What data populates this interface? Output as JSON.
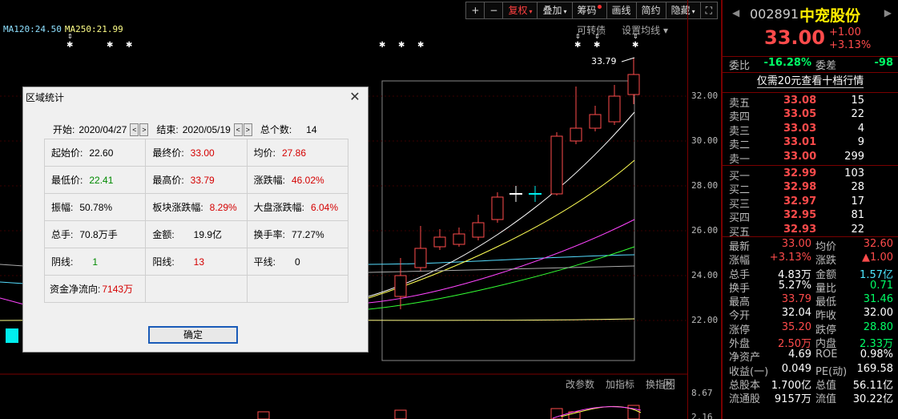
{
  "toolbar": {
    "plus": "+",
    "minus": "−",
    "restore": "复权",
    "overlay": "叠加",
    "chips": "筹码",
    "draw": "画线",
    "simple": "简约",
    "hide": "隐藏",
    "caret": "▾",
    "fullscreen": "⛶"
  },
  "ma_bar": {
    "ma120": "MA120:24.50",
    "ma250": "MA250:21.99"
  },
  "chart_links": {
    "convertible": "可转债",
    "set_ma": "设置均线 ▾"
  },
  "price_axis": [
    "32.00",
    "30.00",
    "28.00",
    "26.00",
    "24.00",
    "22.00",
    "8.67",
    "2.16"
  ],
  "high_marker": "33.79",
  "indicator_bar": {
    "edit_params": "改参数",
    "add_indicator": "加指标",
    "switch_indicator": "换指标",
    "close": "✕"
  },
  "colors": {
    "up": "#ff4b4b",
    "down": "#00ff66",
    "ma5": "#ffffff",
    "ma10": "#ffff55",
    "ma20": "#ff44ff",
    "ma30": "#33ff33",
    "ma60": "#55ddff",
    "ma120": "#8ee0ff",
    "ma250": "#ffff88"
  },
  "dialog": {
    "title": "区域统计",
    "close": "✕",
    "start_label": "开始:",
    "start_date": "2020/04/27",
    "end_label": "结束:",
    "end_date": "2020/05/19",
    "count_label": "总个数:",
    "count": "14",
    "prev": "<",
    "next": ">",
    "stats": {
      "open_label": "起始价:",
      "open": "22.60",
      "close_label": "最终价:",
      "close": "33.00",
      "avg_label": "均价:",
      "avg": "27.86",
      "low_label": "最低价:",
      "low": "22.41",
      "high_label": "最高价:",
      "high": "33.79",
      "rise_label": "涨跌幅:",
      "rise": "46.02%",
      "amp_label": "振幅:",
      "amp": "50.78%",
      "sector_label": "板块涨跌幅:",
      "sector": "8.29%",
      "market_label": "大盘涨跌幅:",
      "market": "6.04%",
      "vol_label": "总手:",
      "vol": "70.8万手",
      "amount_label": "金额:",
      "amount": "19.9亿",
      "turnover_label": "换手率:",
      "turnover": "77.27%",
      "down_label": "阴线:",
      "down": "1",
      "up_label": "阳线:",
      "up": "13",
      "flat_label": "平线:",
      "flat": "0",
      "flow_label": "资金净流向:",
      "flow": "7143万"
    },
    "ok": "确定"
  },
  "right_panel": {
    "nav_left": "◀",
    "nav_right": "▶",
    "code": "002891",
    "name": "中宠股份",
    "price": "33.00",
    "change": "+1.00",
    "change_pct": "+3.13%",
    "webi_label": "委比",
    "webi": "-16.28%",
    "weicha_label": "委差",
    "weicha": "-98",
    "ten_level": "仅需20元查看十档行情",
    "asks": [
      {
        "label": "卖五",
        "price": "33.08",
        "vol": "15"
      },
      {
        "label": "卖四",
        "price": "33.05",
        "vol": "22"
      },
      {
        "label": "卖三",
        "price": "33.03",
        "vol": "4"
      },
      {
        "label": "卖二",
        "price": "33.01",
        "vol": "9"
      },
      {
        "label": "卖一",
        "price": "33.00",
        "vol": "299"
      }
    ],
    "bids": [
      {
        "label": "买一",
        "price": "32.99",
        "vol": "103"
      },
      {
        "label": "买二",
        "price": "32.98",
        "vol": "28"
      },
      {
        "label": "买三",
        "price": "32.97",
        "vol": "17"
      },
      {
        "label": "买四",
        "price": "32.95",
        "vol": "81"
      },
      {
        "label": "买五",
        "price": "32.93",
        "vol": "22"
      }
    ],
    "stats": [
      {
        "l1": "最新",
        "v1": "33.00",
        "c1": "red",
        "l2": "均价",
        "v2": "32.60",
        "c2": "red"
      },
      {
        "l1": "涨幅",
        "v1": "+3.13%",
        "c1": "red",
        "l2": "涨跌",
        "v2": "▲1.00",
        "c2": "red"
      },
      {
        "l1": "总手",
        "v1": "4.83万",
        "c1": "white",
        "l2": "金额",
        "v2": "1.57亿",
        "c2": "cyan"
      },
      {
        "l1": "换手",
        "v1": "5.27%",
        "c1": "white",
        "l2": "量比",
        "v2": "0.71",
        "c2": "green"
      },
      {
        "l1": "最高",
        "v1": "33.79",
        "c1": "red",
        "l2": "最低",
        "v2": "31.46",
        "c2": "green"
      },
      {
        "l1": "今开",
        "v1": "32.04",
        "c1": "white",
        "l2": "昨收",
        "v2": "32.00",
        "c2": "white"
      },
      {
        "l1": "涨停",
        "v1": "35.20",
        "c1": "red",
        "l2": "跌停",
        "v2": "28.80",
        "c2": "green"
      },
      {
        "l1": "外盘",
        "v1": "2.50万",
        "c1": "red",
        "l2": "内盘",
        "v2": "2.33万",
        "c2": "green"
      },
      {
        "l1": "净资产",
        "v1": "4.69",
        "c1": "white",
        "l2": "ROE",
        "v2": "0.98%",
        "c2": "white"
      },
      {
        "l1": "收益(一)",
        "v1": "0.049",
        "c1": "white",
        "l2": "PE(动)",
        "v2": "169.58",
        "c2": "white"
      },
      {
        "l1": "总股本",
        "v1": "1.700亿",
        "c1": "white",
        "l2": "总值",
        "v2": "56.11亿",
        "c2": "white"
      },
      {
        "l1": "流通股",
        "v1": "9157万",
        "c1": "white",
        "l2": "流值",
        "v2": "30.22亿",
        "c2": "white"
      }
    ]
  }
}
